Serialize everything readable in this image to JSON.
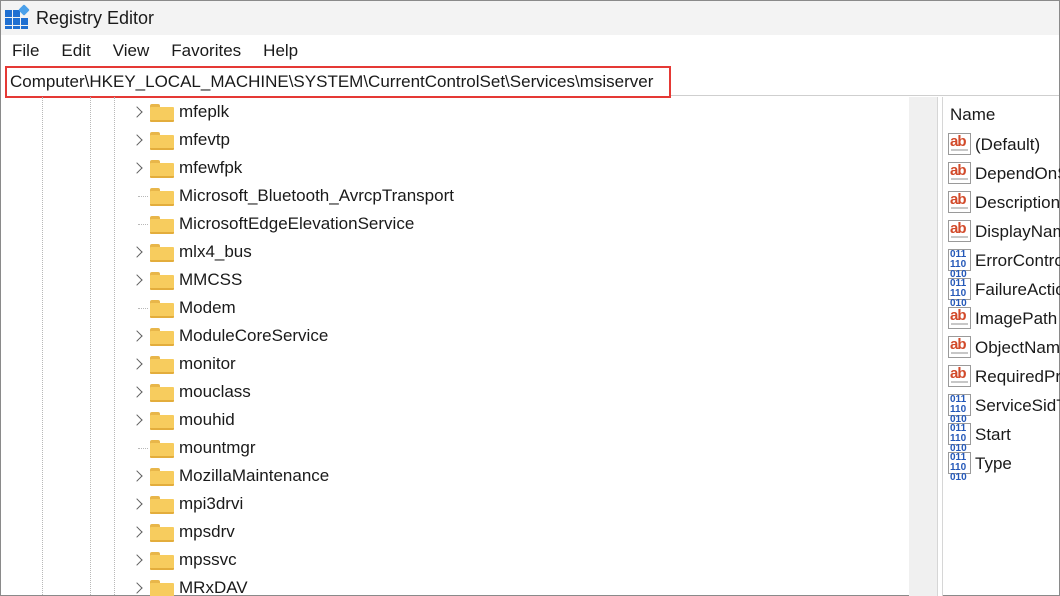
{
  "window": {
    "title": "Registry Editor"
  },
  "menu": {
    "file": "File",
    "edit": "Edit",
    "view": "View",
    "favorites": "Favorites",
    "help": "Help"
  },
  "address": {
    "path": "Computer\\HKEY_LOCAL_MACHINE\\SYSTEM\\CurrentControlSet\\Services\\msiserver"
  },
  "tree": {
    "keys": [
      {
        "label": "mfeplk",
        "expandable": true
      },
      {
        "label": "mfevtp",
        "expandable": true
      },
      {
        "label": "mfewfpk",
        "expandable": true
      },
      {
        "label": "Microsoft_Bluetooth_AvrcpTransport",
        "expandable": false
      },
      {
        "label": "MicrosoftEdgeElevationService",
        "expandable": false
      },
      {
        "label": "mlx4_bus",
        "expandable": true
      },
      {
        "label": "MMCSS",
        "expandable": true
      },
      {
        "label": "Modem",
        "expandable": false
      },
      {
        "label": "ModuleCoreService",
        "expandable": true
      },
      {
        "label": "monitor",
        "expandable": true
      },
      {
        "label": "mouclass",
        "expandable": true
      },
      {
        "label": "mouhid",
        "expandable": true
      },
      {
        "label": "mountmgr",
        "expandable": false
      },
      {
        "label": "MozillaMaintenance",
        "expandable": true
      },
      {
        "label": "mpi3drvi",
        "expandable": true
      },
      {
        "label": "mpsdrv",
        "expandable": true
      },
      {
        "label": "mpssvc",
        "expandable": true
      },
      {
        "label": "MRxDAV",
        "expandable": true
      }
    ]
  },
  "values_pane": {
    "column_name": "Name",
    "values": [
      {
        "name": "(Default)",
        "kind": "string"
      },
      {
        "name": "DependOnService",
        "kind": "string"
      },
      {
        "name": "Description",
        "kind": "string"
      },
      {
        "name": "DisplayName",
        "kind": "string"
      },
      {
        "name": "ErrorControl",
        "kind": "binary"
      },
      {
        "name": "FailureActions",
        "kind": "binary"
      },
      {
        "name": "ImagePath",
        "kind": "string"
      },
      {
        "name": "ObjectName",
        "kind": "string"
      },
      {
        "name": "RequiredPrivileges",
        "kind": "string"
      },
      {
        "name": "ServiceSidType",
        "kind": "binary"
      },
      {
        "name": "Start",
        "kind": "binary"
      },
      {
        "name": "Type",
        "kind": "binary"
      }
    ]
  },
  "colors": {
    "address_highlight": "#e53935",
    "folder": "#f7cc5e",
    "string_icon": "#d24a2a",
    "binary_icon": "#2458b8"
  }
}
